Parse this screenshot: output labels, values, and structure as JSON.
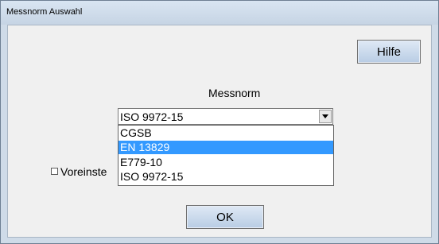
{
  "window": {
    "title": "Messnorm Auswahl"
  },
  "buttons": {
    "help_label": "Hilfe",
    "ok_label": "OK"
  },
  "messnorm": {
    "label": "Messnorm",
    "selected_value": "ISO 9972-15",
    "options": [
      "CGSB",
      "EN 13829",
      "E779-10",
      "ISO 9972-15"
    ],
    "highlighted_option": "EN 13829"
  },
  "checkbox": {
    "label": "Voreinste",
    "checked": false
  },
  "colors": {
    "highlight": "#3399ff",
    "client_bg": "#f0f0f0",
    "frame": "#cfdbe8"
  }
}
